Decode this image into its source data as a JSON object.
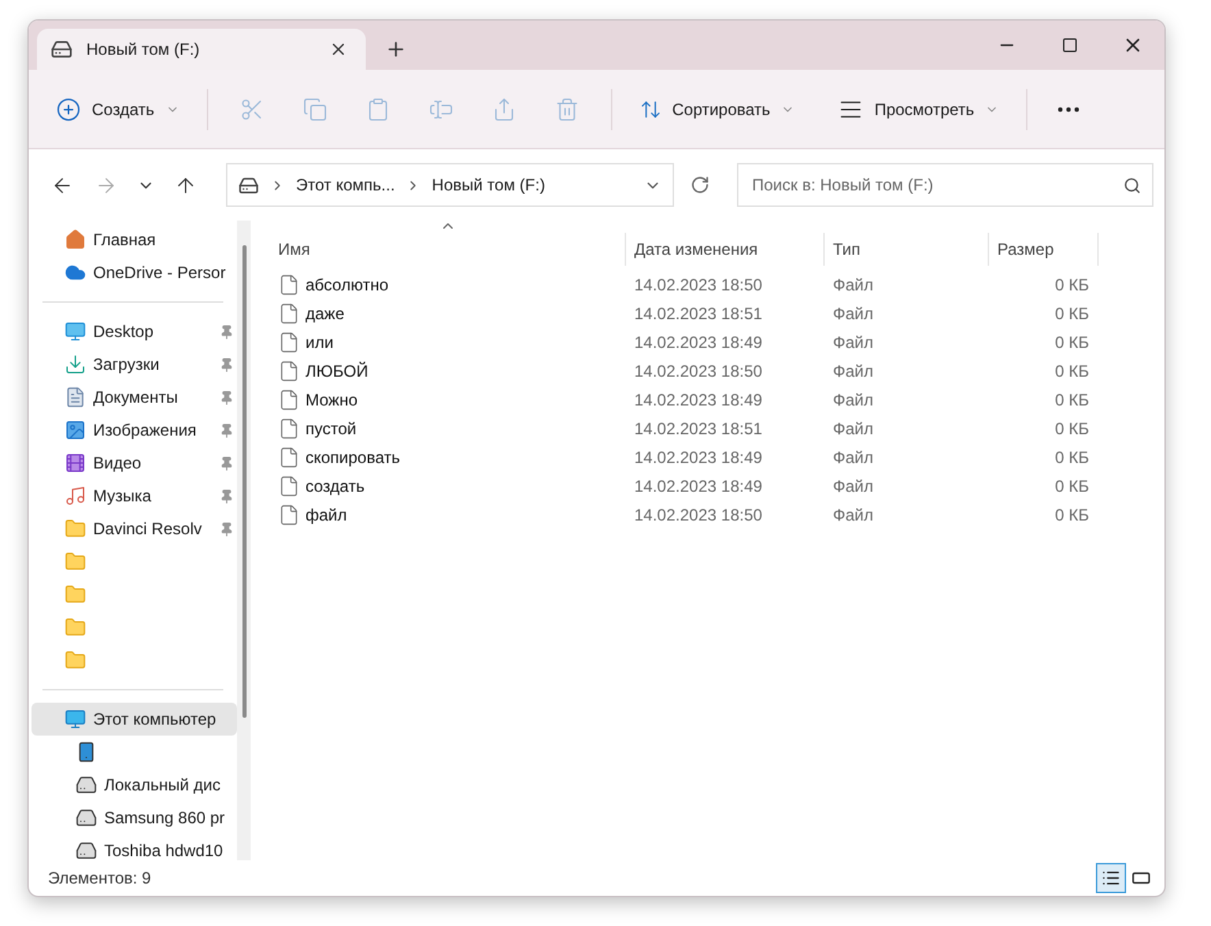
{
  "window": {
    "tab_title": "Новый том (F:)"
  },
  "toolbar": {
    "create": {
      "label": "Создать"
    },
    "actions": [
      {
        "kind": "cut",
        "disabled": true
      },
      {
        "kind": "copy",
        "disabled": true
      },
      {
        "kind": "paste",
        "disabled": true
      },
      {
        "kind": "rename",
        "disabled": true
      },
      {
        "kind": "share",
        "disabled": true
      },
      {
        "kind": "delete",
        "disabled": true
      }
    ],
    "sort": {
      "label": "Сортировать"
    },
    "view": {
      "label": "Просмотреть"
    }
  },
  "address": {
    "back_disabled": false,
    "forward_disabled": true,
    "crumbs": [
      "Этот компь...",
      "Новый том (F:)"
    ]
  },
  "search": {
    "placeholder": "Поиск в: Новый том (F:)"
  },
  "sidebar": {
    "items": [
      {
        "kind": "home",
        "label": "Главная",
        "selected": false
      },
      {
        "kind": "cloud",
        "label": "OneDrive - Persor",
        "selected": false
      },
      {
        "kind": "divider"
      },
      {
        "kind": "desktop",
        "label": "Desktop",
        "pinned": true,
        "selected": false
      },
      {
        "kind": "downloads",
        "label": "Загрузки",
        "pinned": true,
        "selected": false
      },
      {
        "kind": "documents",
        "label": "Документы",
        "pinned": true,
        "selected": false
      },
      {
        "kind": "pictures",
        "label": "Изображения",
        "pinned": true,
        "selected": false
      },
      {
        "kind": "video",
        "label": "Видео",
        "pinned": true,
        "selected": false
      },
      {
        "kind": "music",
        "label": "Музыка",
        "pinned": true,
        "selected": false
      },
      {
        "kind": "folder",
        "label": "Davinci Resolv",
        "pinned": true,
        "selected": false
      },
      {
        "kind": "folder",
        "selected": false
      },
      {
        "kind": "folder",
        "selected": false
      },
      {
        "kind": "folder",
        "selected": false
      },
      {
        "kind": "folder",
        "selected": false
      },
      {
        "kind": "divider"
      },
      {
        "kind": "computer",
        "label": "Этот компьютер",
        "selected": true,
        "children": [
          {
            "kind": "phone",
            "selected": false
          },
          {
            "kind": "system-drive",
            "label": "Локальный дис",
            "selected": false
          },
          {
            "kind": "drive",
            "label": "Samsung 860 pr",
            "selected": false
          },
          {
            "kind": "drive",
            "label": "Toshiba hdwd10",
            "selected": false
          }
        ]
      }
    ]
  },
  "table": {
    "columns": [
      {
        "label": "Имя",
        "sorted": true
      },
      {
        "label": "Дата изменения"
      },
      {
        "label": "Тип"
      },
      {
        "label": "Размер"
      }
    ],
    "rows": [
      {
        "name": "абсолютно",
        "date": "14.02.2023 18:50",
        "type": "Файл",
        "size": "0 КБ"
      },
      {
        "name": "даже",
        "date": "14.02.2023 18:51",
        "type": "Файл",
        "size": "0 КБ"
      },
      {
        "name": "или",
        "date": "14.02.2023 18:49",
        "type": "Файл",
        "size": "0 КБ"
      },
      {
        "name": "ЛЮБОЙ",
        "date": "14.02.2023 18:50",
        "type": "Файл",
        "size": "0 КБ"
      },
      {
        "name": "Можно",
        "date": "14.02.2023 18:49",
        "type": "Файл",
        "size": "0 КБ"
      },
      {
        "name": "пустой",
        "date": "14.02.2023 18:51",
        "type": "Файл",
        "size": "0 КБ"
      },
      {
        "name": "скопировать",
        "date": "14.02.2023 18:49",
        "type": "Файл",
        "size": "0 КБ"
      },
      {
        "name": "создать",
        "date": "14.02.2023 18:49",
        "type": "Файл",
        "size": "0 КБ"
      },
      {
        "name": "файл",
        "date": "14.02.2023 18:50",
        "type": "Файл",
        "size": "0 КБ"
      }
    ]
  },
  "status_bar": {
    "count": "Элементов: 9",
    "views": [
      {
        "kind": "details",
        "selected": true
      },
      {
        "kind": "tiles",
        "selected": false
      }
    ]
  }
}
